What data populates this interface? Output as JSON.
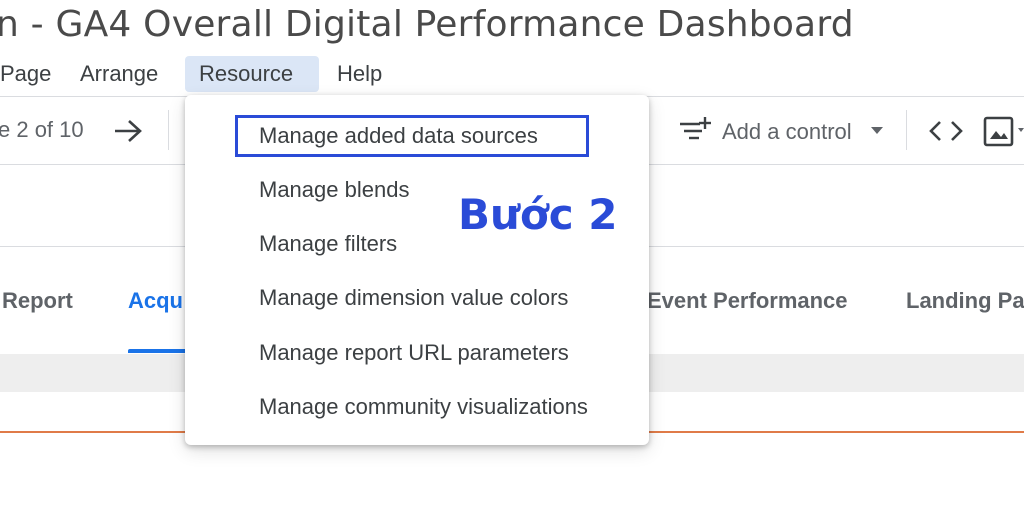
{
  "window": {
    "title": "n - GA4 Overall Digital Performance Dashboard"
  },
  "menubar": {
    "items": [
      {
        "label": "Page"
      },
      {
        "label": "Arrange"
      },
      {
        "label": "Resource"
      },
      {
        "label": "Help"
      }
    ]
  },
  "toolbar": {
    "page_indicator": "e 2 of 10",
    "add_control_label": "Add a control",
    "icons": [
      "next-page-arrow-icon",
      "add-control-icon",
      "dropdown-caret-icon",
      "embed-code-icon",
      "image-icon"
    ]
  },
  "tabs": [
    {
      "label": "Report"
    },
    {
      "label": "Acqu"
    },
    {
      "label": "Event Performance"
    },
    {
      "label": "Landing Pa"
    }
  ],
  "resource_menu": {
    "items": [
      {
        "label": "Manage added data sources"
      },
      {
        "label": "Manage blends"
      },
      {
        "label": "Manage filters"
      },
      {
        "label": "Manage dimension value colors"
      },
      {
        "label": "Manage report URL parameters"
      },
      {
        "label": "Manage community visualizations"
      }
    ]
  },
  "annotation": {
    "text": "Bước 2",
    "color": "#2a4bd7"
  },
  "colors": {
    "accent": "#1a73e8",
    "menu_active_bg": "#dbe6f6",
    "orange_line": "#e07b48"
  }
}
